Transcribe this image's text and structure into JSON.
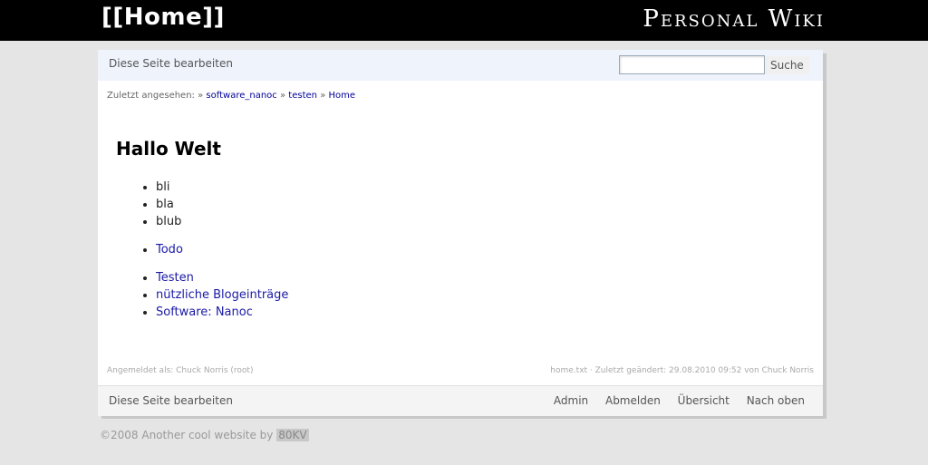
{
  "header": {
    "home_link": "[[Home]]",
    "site_title": "Personal Wiki"
  },
  "toolbar_top": {
    "edit_label": "Diese Seite bearbeiten",
    "search_value": "",
    "search_button": "Suche"
  },
  "breadcrumb": {
    "prefix": "Zuletzt angesehen:",
    "separator": "»",
    "items": [
      "software_nanoc",
      "testen",
      "Home"
    ]
  },
  "content": {
    "title": "Hallo Welt",
    "list1": [
      "bli",
      "bla",
      "blub"
    ],
    "list2": [
      "Todo"
    ],
    "list3": [
      "Testen",
      "nützliche Blogeinträge",
      "Software: Nanoc"
    ]
  },
  "meta": {
    "logged_in": "Angemeldet als: Chuck Norris (root)",
    "file_info": "home.txt · Zuletzt geändert: 29.08.2010 09:52 von Chuck Norris"
  },
  "toolbar_bottom": {
    "edit_label": "Diese Seite bearbeiten",
    "links": [
      "Admin",
      "Abmelden",
      "Übersicht",
      "Nach oben"
    ]
  },
  "footer": {
    "text": "©2008 Another cool website by",
    "badge": "80KV"
  }
}
